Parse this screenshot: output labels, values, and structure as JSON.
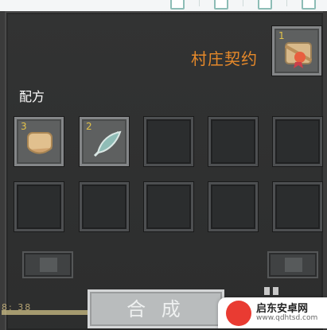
{
  "contract": {
    "title": "村庄契约",
    "count": "1",
    "icon": "contract-scroll-seal-icon"
  },
  "recipe": {
    "label": "配方"
  },
  "slots": [
    {
      "count": "3",
      "icon": "paper-scroll-icon"
    },
    {
      "count": "2",
      "icon": "feather-icon"
    },
    {},
    {},
    {},
    {},
    {},
    {},
    {},
    {}
  ],
  "craft": {
    "label": "合 成"
  },
  "hud": {
    "text": "8: 38"
  },
  "watermark": {
    "title": "启东安卓网",
    "url": "www.qdhtsd.com"
  },
  "colors": {
    "accent": "#e6892a",
    "count": "#e2c24a",
    "button": "#b9bcbd"
  }
}
